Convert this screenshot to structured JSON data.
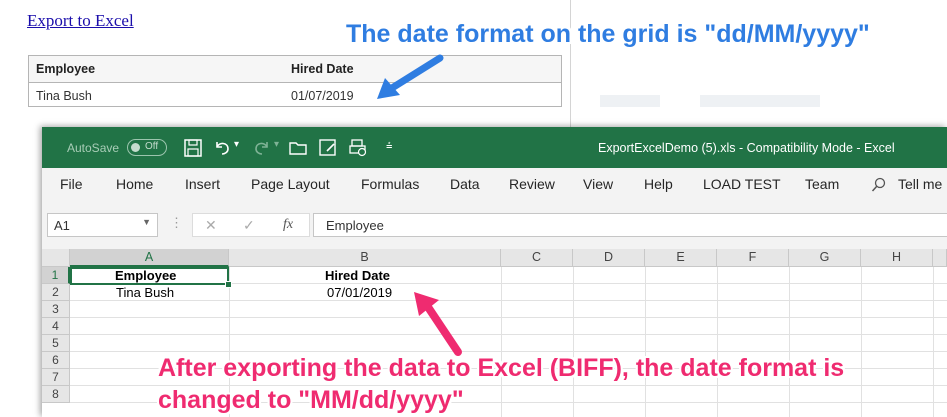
{
  "web": {
    "export_link": "Export to Excel",
    "grid": {
      "columns": [
        "Employee",
        "Hired Date"
      ],
      "rows": [
        [
          "Tina Bush",
          "01/07/2019"
        ]
      ]
    }
  },
  "excel": {
    "autosave_label": "AutoSave",
    "autosave_state": "Off",
    "title": "ExportExcelDemo (5).xls  -  Compatibility Mode  -  Excel",
    "ribbon_tabs": [
      "File",
      "Home",
      "Insert",
      "Page Layout",
      "Formulas",
      "Data",
      "Review",
      "View",
      "Help",
      "LOAD TEST",
      "Team"
    ],
    "tell_me": "Tell me",
    "name_box": "A1",
    "formula_content": "Employee",
    "fx_label": "fx",
    "columns": [
      "A",
      "B",
      "C",
      "D",
      "E",
      "F",
      "G",
      "H"
    ],
    "rows": [
      "1",
      "2",
      "3",
      "4",
      "5",
      "6",
      "7",
      "8"
    ],
    "cells": {
      "a1": "Employee",
      "b1": "Hired Date",
      "a2": "Tina Bush",
      "b2": "07/01/2019"
    },
    "accent_color": "#217346"
  },
  "annotations": {
    "top": "The date format on the grid is \"dd/MM/yyyy\"",
    "bottom_line1": "After exporting the data to Excel (BIFF), the date format is",
    "bottom_line2": "changed to \"MM/dd/yyyy\"",
    "top_color": "#2f7de1",
    "bottom_color": "#ef2b70"
  }
}
